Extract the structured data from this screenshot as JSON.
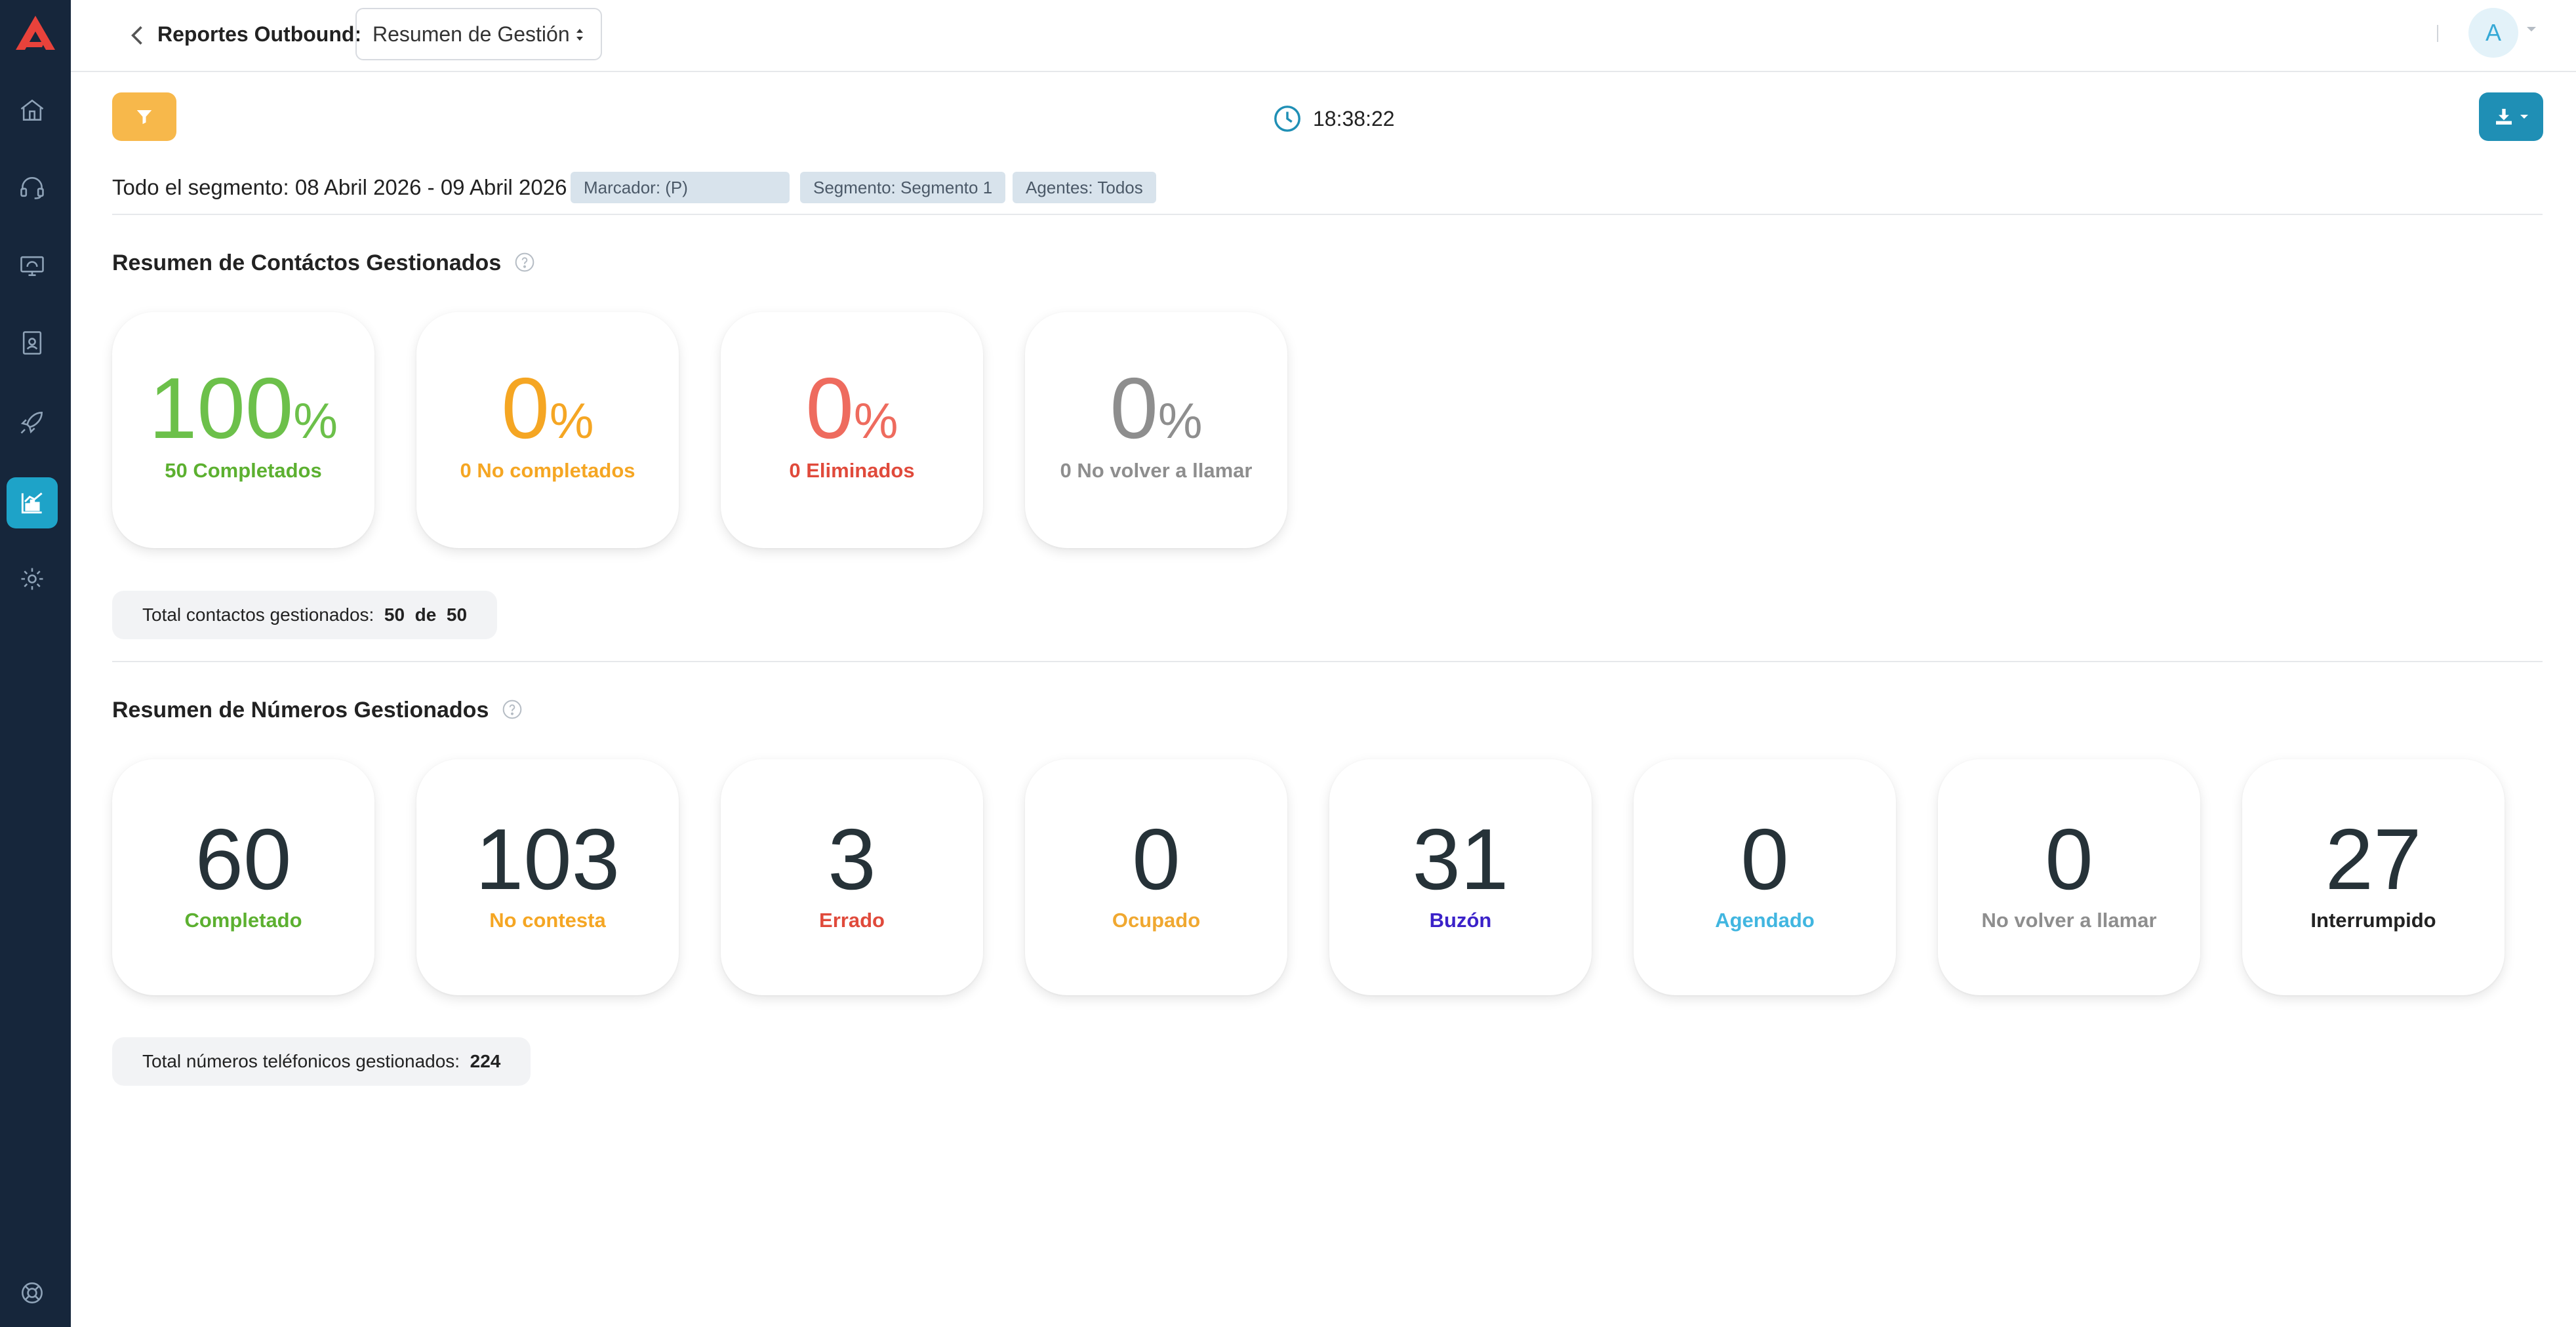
{
  "topbar": {
    "report_label": "Reportes Outbound:",
    "report_select_value": "Resumen de Gestión",
    "avatar_initial": "A"
  },
  "toolbar": {
    "clock_time": "18:38:22"
  },
  "segment": {
    "text": "Todo el segmento: 08 Abril 2026 - 09 Abril 2026",
    "badges": [
      "Marcador: (P)",
      "Segmento: Segmento 1",
      "Agentes: Todos"
    ]
  },
  "contacts": {
    "title": "Resumen de Contáctos Gestionados",
    "cards": [
      {
        "value": "100",
        "sign": "%",
        "label": "50 Completados",
        "color": "#6cc04a",
        "label_color": "#5cb030"
      },
      {
        "value": "0",
        "sign": "%",
        "label": "0 No completados",
        "color": "#f5a623",
        "label_color": "#f5a623"
      },
      {
        "value": "0",
        "sign": "%",
        "label": "0 Eliminados",
        "color": "#ee6b5e",
        "label_color": "#e04a3b"
      },
      {
        "value": "0",
        "sign": "%",
        "label": "0 No volver a llamar",
        "color": "#8e8e8e",
        "label_color": "#8e8e8e"
      }
    ],
    "total_label": "Total contactos gestionados:",
    "total_value": "50",
    "total_of": "de",
    "total_max": "50"
  },
  "numbers": {
    "title": "Resumen de Números Gestionados",
    "cards": [
      {
        "value": "60",
        "label": "Completado",
        "label_color": "#5cb030"
      },
      {
        "value": "103",
        "label": "No contesta",
        "label_color": "#f5a623"
      },
      {
        "value": "3",
        "label": "Errado",
        "label_color": "#e04a3b"
      },
      {
        "value": "0",
        "label": "Ocupado",
        "label_color": "#f0a830"
      },
      {
        "value": "31",
        "label": "Buzón",
        "label_color": "#3b22c9"
      },
      {
        "value": "0",
        "label": "Agendado",
        "label_color": "#41b6e0"
      },
      {
        "value": "0",
        "label": "No volver a llamar",
        "label_color": "#8e8e8e"
      },
      {
        "value": "27",
        "label": "Interrumpido",
        "label_color": "#222222"
      }
    ],
    "total_label": "Total números teléfonicos gestionados:",
    "total_value": "224"
  },
  "sidebar": {
    "icons": [
      "home-icon",
      "headset-icon",
      "monitor-icon",
      "contacts-book-icon",
      "campaign-rocket-icon",
      "reports-chart-icon",
      "settings-gear-icon",
      "support-lifebuoy-icon"
    ],
    "active": "reports-chart-icon"
  },
  "colors": {
    "sidebar": "#16263b",
    "accent": "#1ea3c8",
    "filter_button": "#f7b84b",
    "download_button": "#1f8fb5"
  }
}
